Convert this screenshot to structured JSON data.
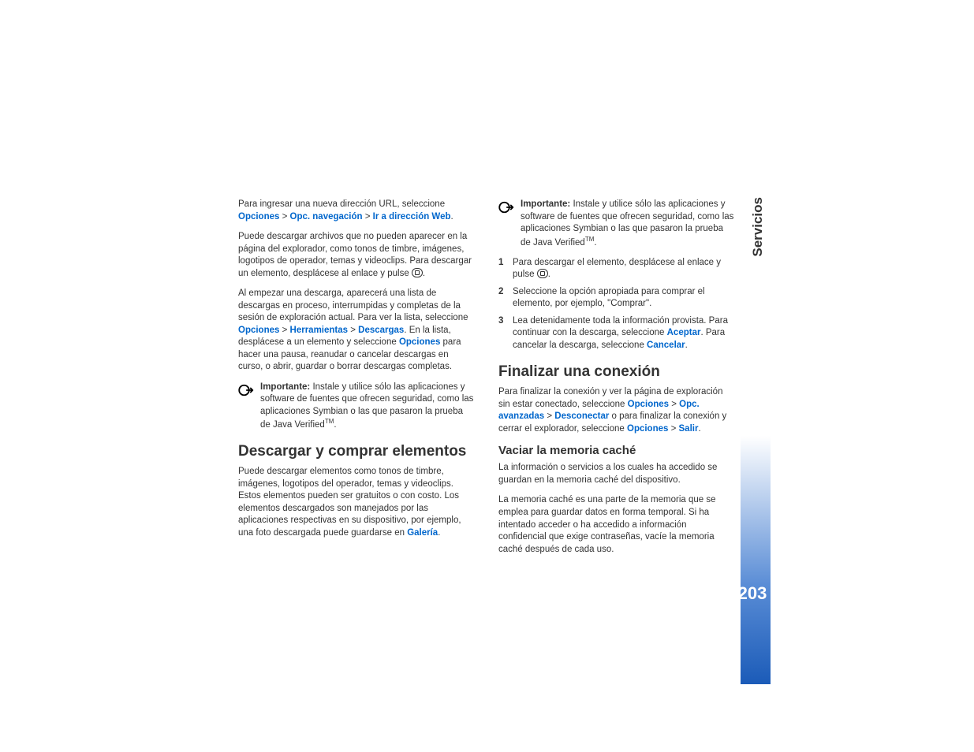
{
  "side": {
    "section": "Servicios",
    "page_number": "203"
  },
  "col1": {
    "p1_a": "Para ingresar una nueva dirección URL, seleccione ",
    "p1_link1": "Opciones",
    "p1_sep": " > ",
    "p1_link2": "Opc. navegación",
    "p1_link3": "Ir a dirección Web",
    "p1_end": ".",
    "p2": "Puede descargar archivos que no pueden aparecer en la página del explorador, como tonos de timbre, imágenes, logotipos de operador, temas y videoclips. Para descargar un elemento, desplácese al enlace y pulse ",
    "p2_end": ".",
    "p3_a": "Al empezar una descarga, aparecerá una lista de descargas en proceso, interrumpidas y completas de la sesión de exploración actual. Para ver la lista, seleccione ",
    "p3_link1": "Opciones",
    "p3_link2": "Herramientas",
    "p3_link3": "Descargas",
    "p3_b": ". En la lista, desplácese a un elemento y seleccione ",
    "p3_link4": "Opciones",
    "p3_c": " para hacer una pausa, reanudar o cancelar descargas en curso, o abrir, guardar o borrar descargas completas.",
    "note1_label": "Importante:",
    "note1_text": " Instale y utilice sólo las aplicaciones y software de fuentes que ofrecen seguridad, como las aplicaciones Symbian o las que pasaron la prueba de Java Verified",
    "note1_tm": "TM",
    "note1_end": ".",
    "h1": "Descargar y comprar elementos",
    "p4_a": "Puede descargar elementos como tonos de timbre, imágenes, logotipos del operador, temas y videoclips. Estos elementos pueden ser gratuitos o con costo. Los elementos descargados son manejados por las aplicaciones respectivas en su dispositivo, por ejemplo, una foto descargada puede guardarse en ",
    "p4_link1": "Galería",
    "p4_end": "."
  },
  "col2": {
    "note2_label": "Importante:",
    "note2_text": " Instale y utilice sólo las aplicaciones y software de fuentes que ofrecen seguridad, como las aplicaciones Symbian o las que pasaron la prueba de Java Verified",
    "note2_tm": "TM",
    "note2_end": ".",
    "li1_a": "Para descargar el elemento, desplácese al enlace y pulse ",
    "li1_end": ".",
    "li2": "Seleccione la opción apropiada para comprar el elemento, por ejemplo, \"Comprar\".",
    "li3_a": "Lea detenidamente toda la información provista. Para continuar con la descarga, seleccione ",
    "li3_link1": "Aceptar",
    "li3_b": ". Para cancelar la descarga, seleccione ",
    "li3_link2": "Cancelar",
    "li3_end": ".",
    "h1": "Finalizar una conexión",
    "p5_a": "Para finalizar la conexión y ver la página de exploración sin estar conectado, seleccione ",
    "p5_link1": "Opciones",
    "p5_link2": "Opc. avanzadas",
    "p5_link3": "Desconectar",
    "p5_b": " o para finalizar la conexión y cerrar el explorador, seleccione ",
    "p5_link4": "Opciones",
    "p5_link5": "Salir",
    "p5_end": ".",
    "h2": "Vaciar la memoria caché",
    "p6": "La información o servicios a los cuales ha accedido se guardan en la memoria caché del dispositivo.",
    "p7": "La memoria caché es una parte de la memoria que se emplea para guardar datos en forma temporal. Si ha intentado acceder o ha accedido a información confidencial que exige contraseñas, vacíe la memoria caché después de cada uso."
  }
}
